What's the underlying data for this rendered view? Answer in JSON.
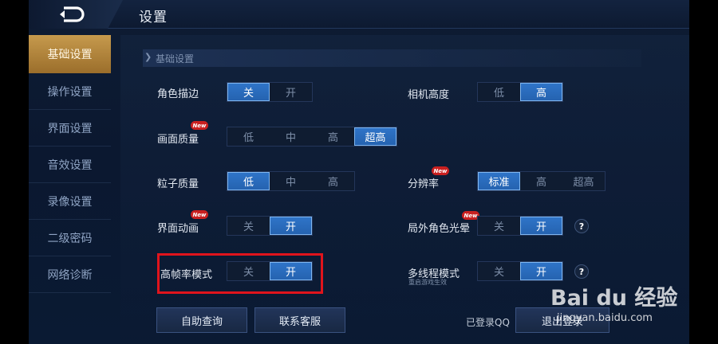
{
  "header": {
    "title": "设置"
  },
  "sidebar": {
    "items": [
      {
        "label": "基础设置",
        "active": true
      },
      {
        "label": "操作设置",
        "active": false
      },
      {
        "label": "界面设置",
        "active": false
      },
      {
        "label": "音效设置",
        "active": false
      },
      {
        "label": "录像设置",
        "active": false
      },
      {
        "label": "二级密码",
        "active": false
      },
      {
        "label": "网络诊断",
        "active": false
      }
    ]
  },
  "section": {
    "title": "基础设置"
  },
  "settings": {
    "outline": {
      "label": "角色描边",
      "options": [
        "关",
        "开"
      ],
      "selected": "关"
    },
    "camera_height": {
      "label": "相机高度",
      "options": [
        "低",
        "高"
      ],
      "selected": "高"
    },
    "graphics_quality": {
      "label": "画面质量",
      "badge": "New",
      "options": [
        "低",
        "中",
        "高",
        "超高"
      ],
      "selected": "超高"
    },
    "particle_quality": {
      "label": "粒子质量",
      "options": [
        "低",
        "中",
        "高"
      ],
      "selected": "低"
    },
    "resolution": {
      "label": "分辨率",
      "badge": "New",
      "options": [
        "标准",
        "高",
        "超高"
      ],
      "selected": "标准"
    },
    "ui_animation": {
      "label": "界面动画",
      "badge": "New",
      "options": [
        "关",
        "开"
      ],
      "selected": "开"
    },
    "outgame_glow": {
      "label": "局外角色光晕",
      "badge": "New",
      "options": [
        "关",
        "开"
      ],
      "selected": "开",
      "help": "?"
    },
    "high_framerate": {
      "label": "高帧率模式",
      "options": [
        "关",
        "开"
      ],
      "selected": "开"
    },
    "multithread": {
      "label": "多线程模式",
      "note": "重启游戏生效",
      "options": [
        "关",
        "开"
      ],
      "selected": "开",
      "help": "?"
    }
  },
  "bottom": {
    "self_query": "自助查询",
    "customer_service": "联系客服",
    "logged_in": "已登录QQ",
    "logout": "退出登录"
  },
  "watermark": {
    "brand": "Bai du 经验",
    "url": "jingyan.baidu.com"
  },
  "colors": {
    "accent": "#2f74c8",
    "active_tab": "#c69a4d",
    "highlight_box": "#e0141c"
  }
}
